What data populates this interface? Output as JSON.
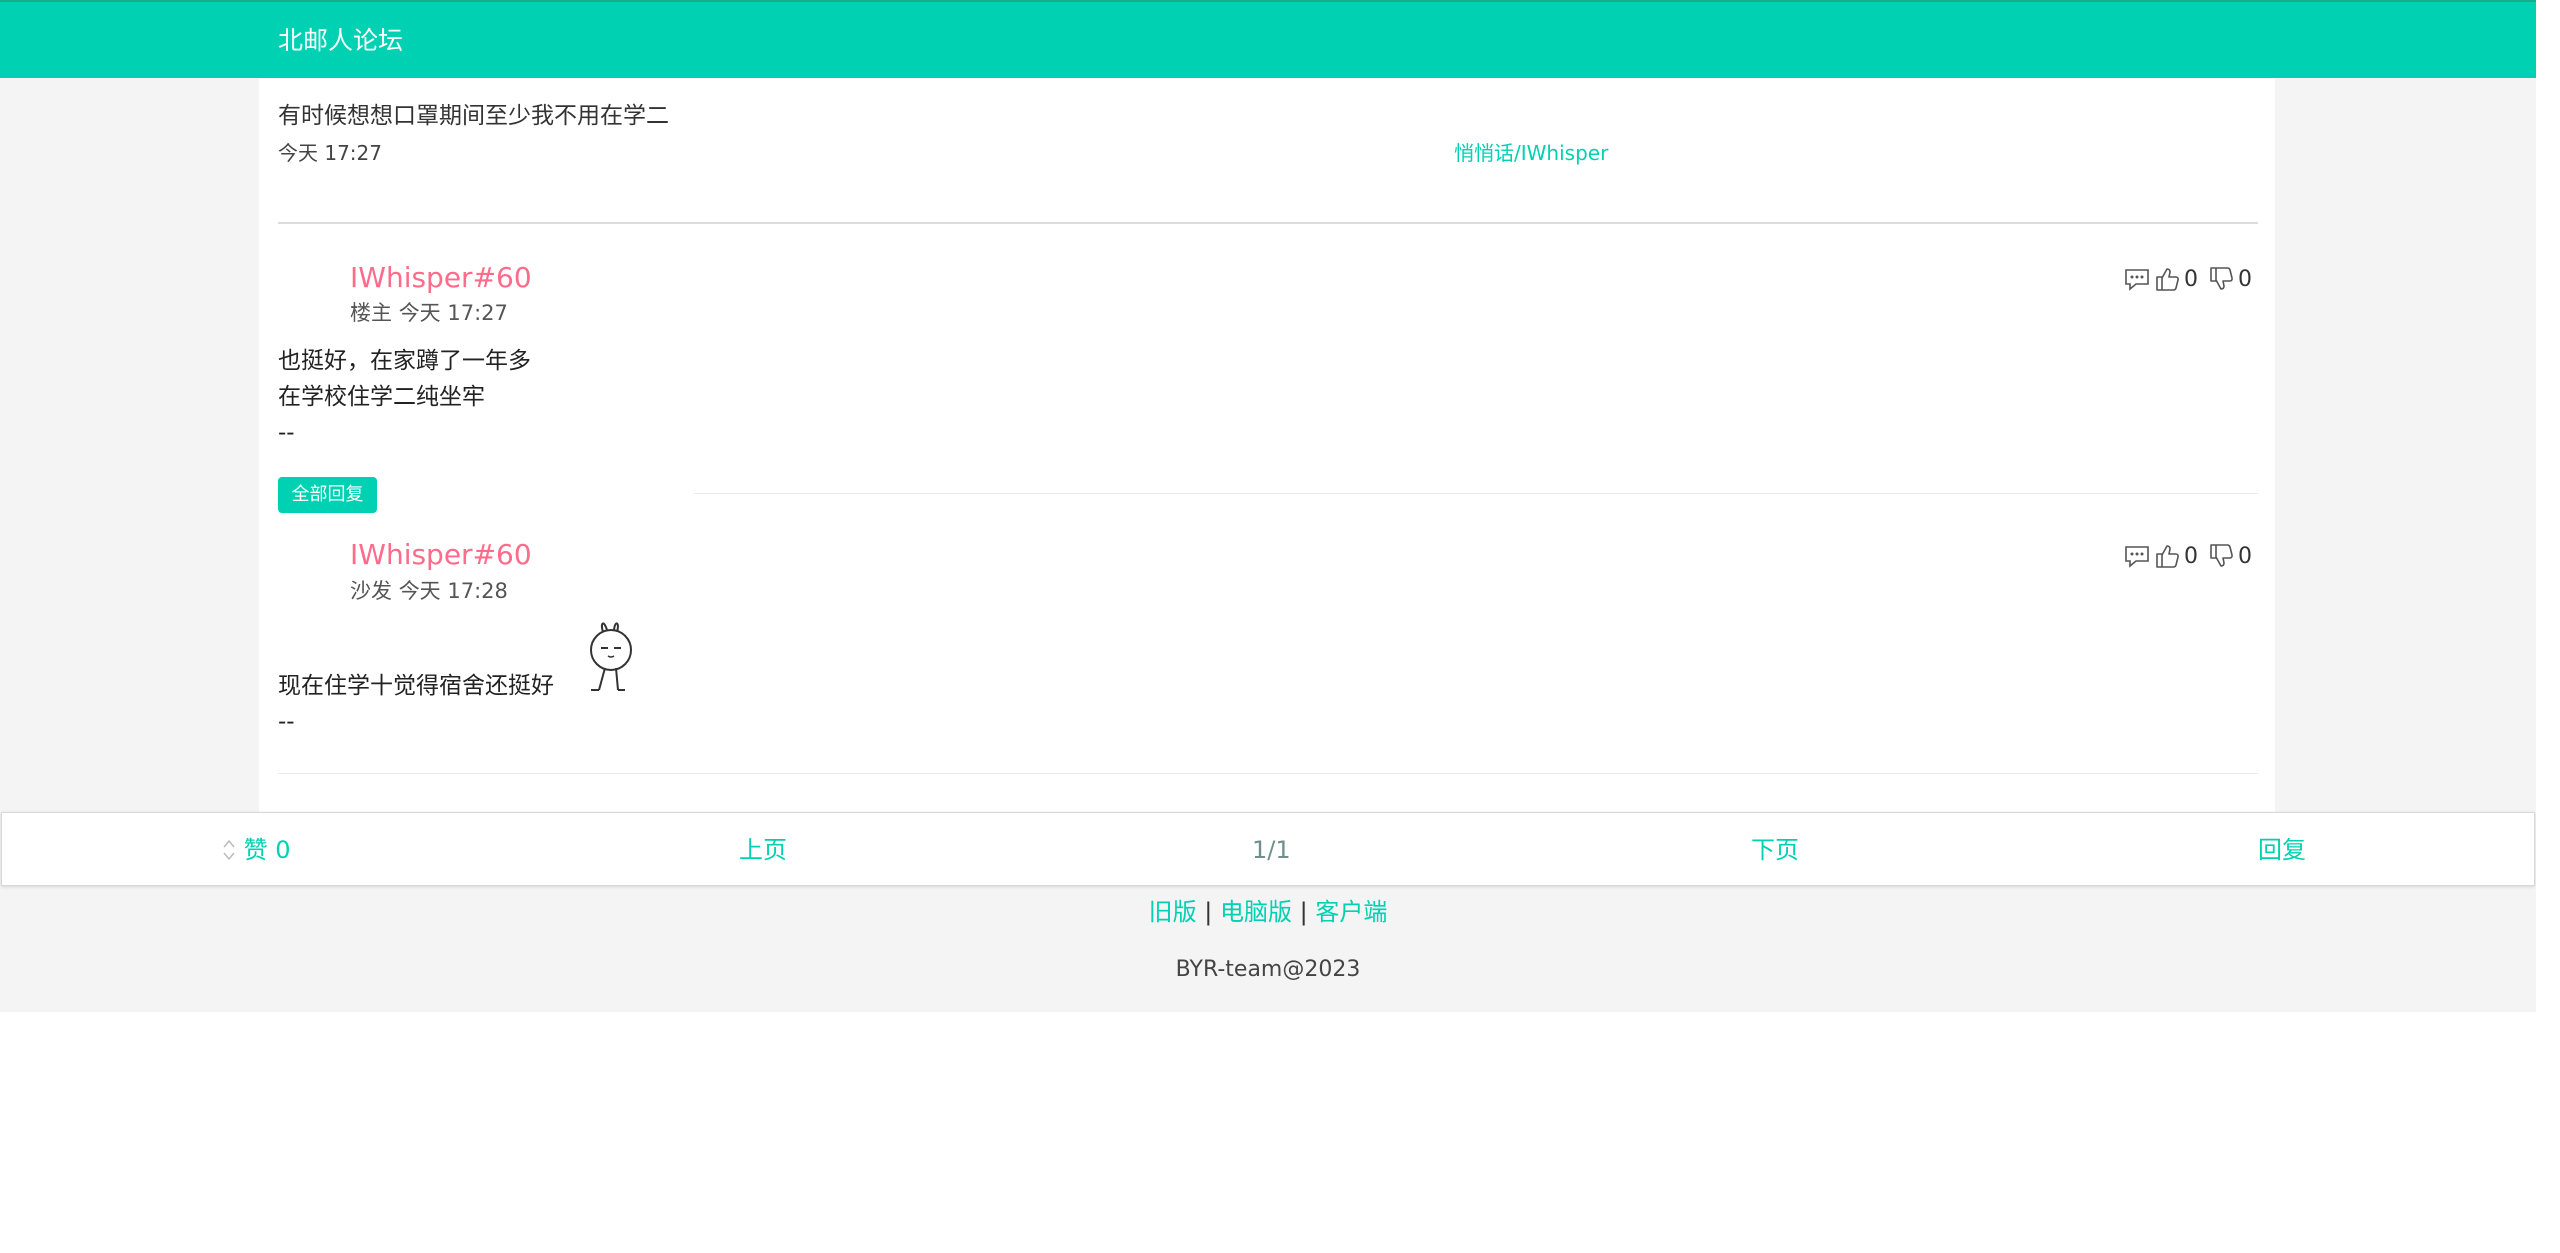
{
  "header": {
    "title": "北邮人论坛"
  },
  "topic": {
    "title": "有时候想想口罩期间至少我不用在学二",
    "time": "今天 17:27",
    "board": "悄悄话/IWhisper"
  },
  "posts": [
    {
      "author": "IWhisper#60",
      "role": "楼主",
      "time": "今天 17:27",
      "lines": [
        "也挺好，在家蹲了一年多",
        "在学校住学二纯坐牢",
        "--"
      ],
      "likes": "0",
      "dislikes": "0"
    },
    {
      "author": "IWhisper#60",
      "role": "沙发",
      "time": "今天 17:28",
      "lines": [
        "现在住学十觉得宿舍还挺好",
        "--"
      ],
      "likes": "0",
      "dislikes": "0"
    }
  ],
  "reply_all_label": "全部回复",
  "bottom_bar": {
    "like_label": "赞 0",
    "prev_label": "上页",
    "page_label": "1/1",
    "next_label": "下页",
    "reply_label": "回复"
  },
  "footer": {
    "old_label": "旧版",
    "sep1": "|",
    "pc_label": "电脑版",
    "sep2": "|",
    "client_label": "客户端",
    "copyright": "BYR-team@2023"
  },
  "colors": {
    "accent": "#00d1b2",
    "author": "#ff6b8a"
  },
  "icons": [
    "comment-icon",
    "thumbs-up-icon",
    "thumbs-down-icon",
    "sort-icon",
    "sticker-icon"
  ]
}
